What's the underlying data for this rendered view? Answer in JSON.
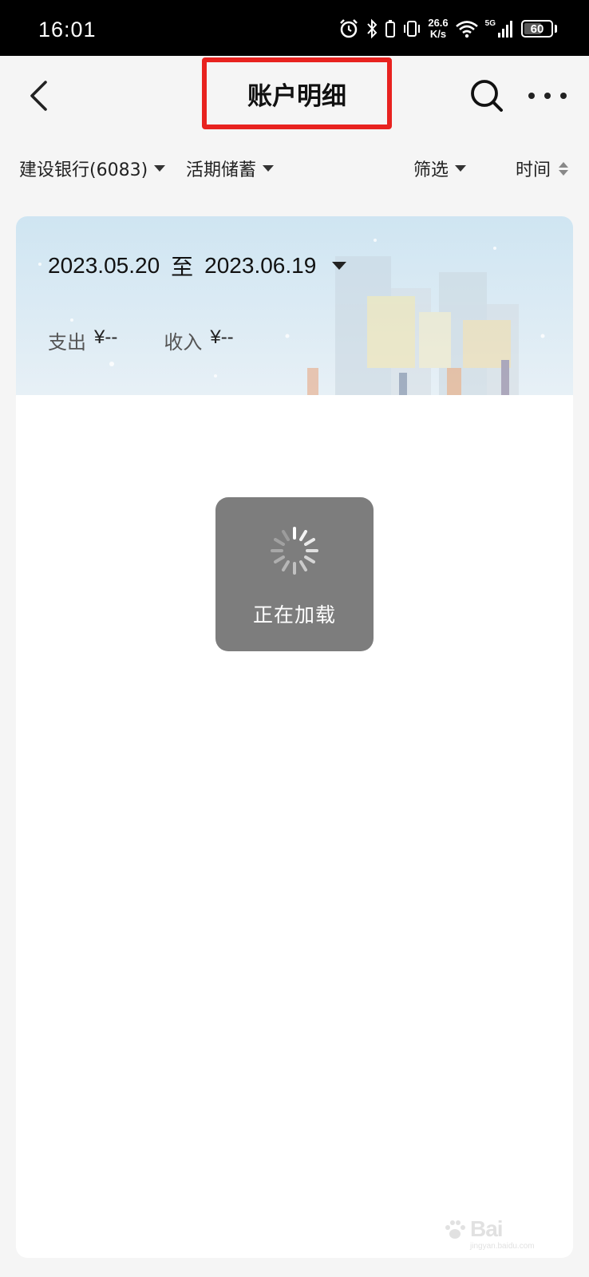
{
  "status_bar": {
    "time": "16:01",
    "net_speed_value": "26.6",
    "net_speed_unit": "K/s",
    "network": "5G",
    "battery_level": "60",
    "icons": [
      "alarm-icon",
      "bluetooth-icon",
      "vibrate-icon",
      "wifi-icon",
      "signal-icon",
      "battery-icon"
    ]
  },
  "header": {
    "title": "账户明细",
    "back_icon": "back-chevron-icon",
    "search_icon": "search-icon",
    "more_icon": "more-dots-icon",
    "highlight_color": "#e8221f"
  },
  "filters": {
    "account": "建设银行(6083)",
    "account_type": "活期储蓄",
    "filter": "筛选",
    "sort": "时间"
  },
  "summary": {
    "date_start": "2023.05.20",
    "date_separator": "至",
    "date_end": "2023.06.19",
    "expense_label": "支出",
    "expense_value": "¥--",
    "income_label": "收入",
    "income_value": "¥--"
  },
  "loading": {
    "text": "正在加载"
  },
  "watermark": {
    "text": "Bai",
    "sub": "jingyan.baidu.com"
  }
}
